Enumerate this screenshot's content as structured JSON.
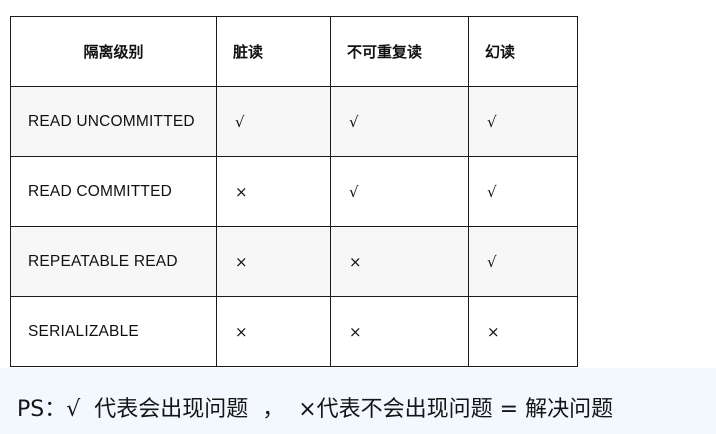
{
  "table": {
    "headers": [
      "隔离级别",
      "脏读",
      "不可重复读",
      "幻读"
    ],
    "rows": [
      {
        "level": "READ UNCOMMITTED",
        "dirty_read": "√",
        "non_repeatable_read": "√",
        "phantom_read": "√"
      },
      {
        "level": "READ COMMITTED",
        "dirty_read": "×",
        "non_repeatable_read": "√",
        "phantom_read": "√"
      },
      {
        "level": "REPEATABLE READ",
        "dirty_read": "×",
        "non_repeatable_read": "×",
        "phantom_read": "√"
      },
      {
        "level": "SERIALIZABLE",
        "dirty_read": "×",
        "non_repeatable_read": "×",
        "phantom_read": "×"
      }
    ]
  },
  "note": {
    "text": "PS：√  代表会出现问题  ，  ×代表不会出现问题 = 解决问题"
  },
  "colors": {
    "border": "#1a1a1a",
    "shaded_row": "#f7f7f7",
    "note_background": "#f2f8fe"
  }
}
